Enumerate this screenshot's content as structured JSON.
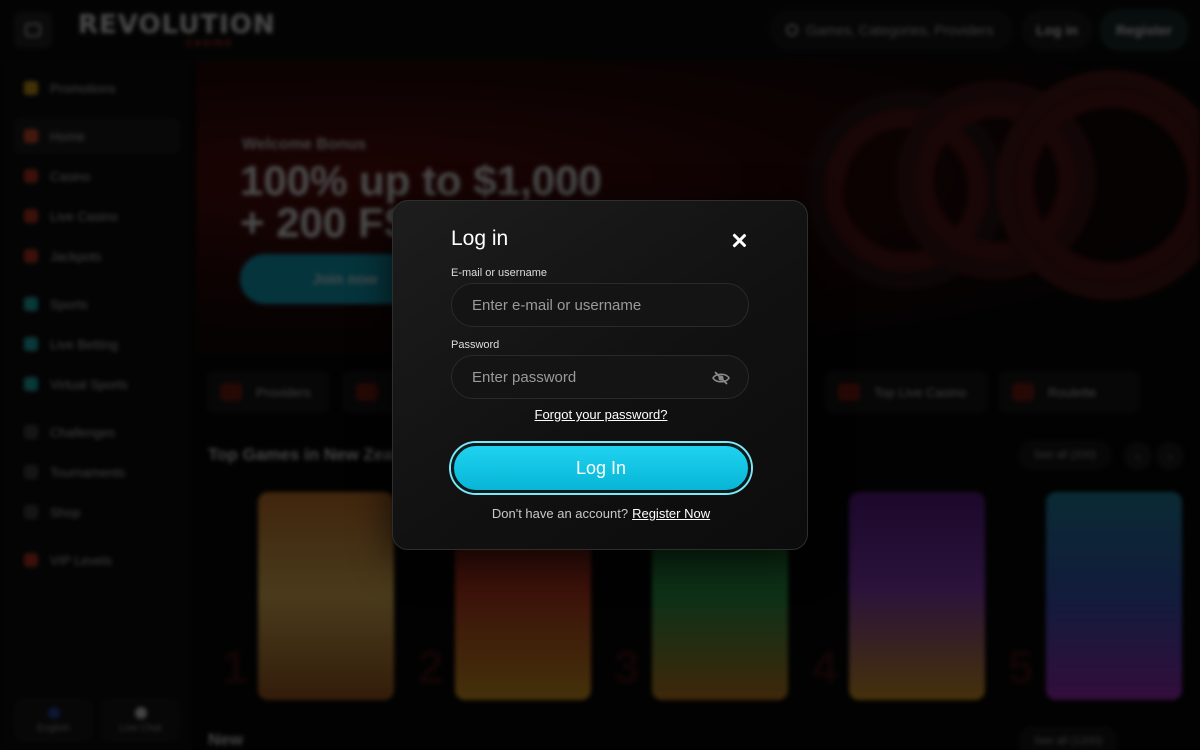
{
  "header": {
    "logo_text": "REVOLUTION",
    "logo_sub": "CASINO",
    "search_placeholder": "Games, Categories, Providers",
    "login_label": "Log in",
    "register_label": "Register"
  },
  "sidebar": {
    "items": [
      {
        "label": "Promotions",
        "color": "#d4a017"
      },
      {
        "label": "Home",
        "color": "#e0502a"
      },
      {
        "label": "Casino",
        "color": "#c2361f"
      },
      {
        "label": "Live Casino",
        "color": "#c2361f"
      },
      {
        "label": "Jackpots",
        "color": "#c2361f"
      },
      {
        "label": "Sports",
        "color": "#1fb5b5"
      },
      {
        "label": "Live Betting",
        "color": "#1fb5b5"
      },
      {
        "label": "Virtual Sports",
        "color": "#1fb5b5"
      },
      {
        "label": "Challenges",
        "color": "#444"
      },
      {
        "label": "Tournaments",
        "color": "#444"
      },
      {
        "label": "Shop",
        "color": "#444"
      },
      {
        "label": "VIP Levels",
        "color": "#c2361f"
      }
    ],
    "bottom": [
      {
        "label": "English"
      },
      {
        "label": "Live Chat"
      }
    ]
  },
  "hero": {
    "eyebrow": "Welcome Bonus",
    "headline_line1": "100% up to $1,000",
    "headline_line2": "+ 200 FS",
    "cta_label": "Join now"
  },
  "categories": [
    {
      "label": "Providers"
    },
    {
      "label": ""
    },
    {
      "label": "Top Live Casino"
    },
    {
      "label": "Roulette"
    }
  ],
  "sections": {
    "top_games_title": "Top Games in New Zealand",
    "top_games_see_all": "See all (200)",
    "second_title": "New",
    "second_see_all": "See all (1200)"
  },
  "game_ranks": [
    "1",
    "2",
    "3",
    "4",
    "5"
  ],
  "modal": {
    "title": "Log in",
    "email_label": "E-mail or username",
    "email_placeholder": "Enter e-mail or username",
    "email_value": "",
    "password_label": "Password",
    "password_placeholder": "Enter password",
    "password_value": "",
    "forgot_label": "Forgot your password?",
    "submit_label": "Log In",
    "no_account_text": "Don't have an account?",
    "register_link": "Register Now"
  },
  "colors": {
    "accent_cyan": "#08b5d6",
    "brand_red": "#e0332f"
  }
}
